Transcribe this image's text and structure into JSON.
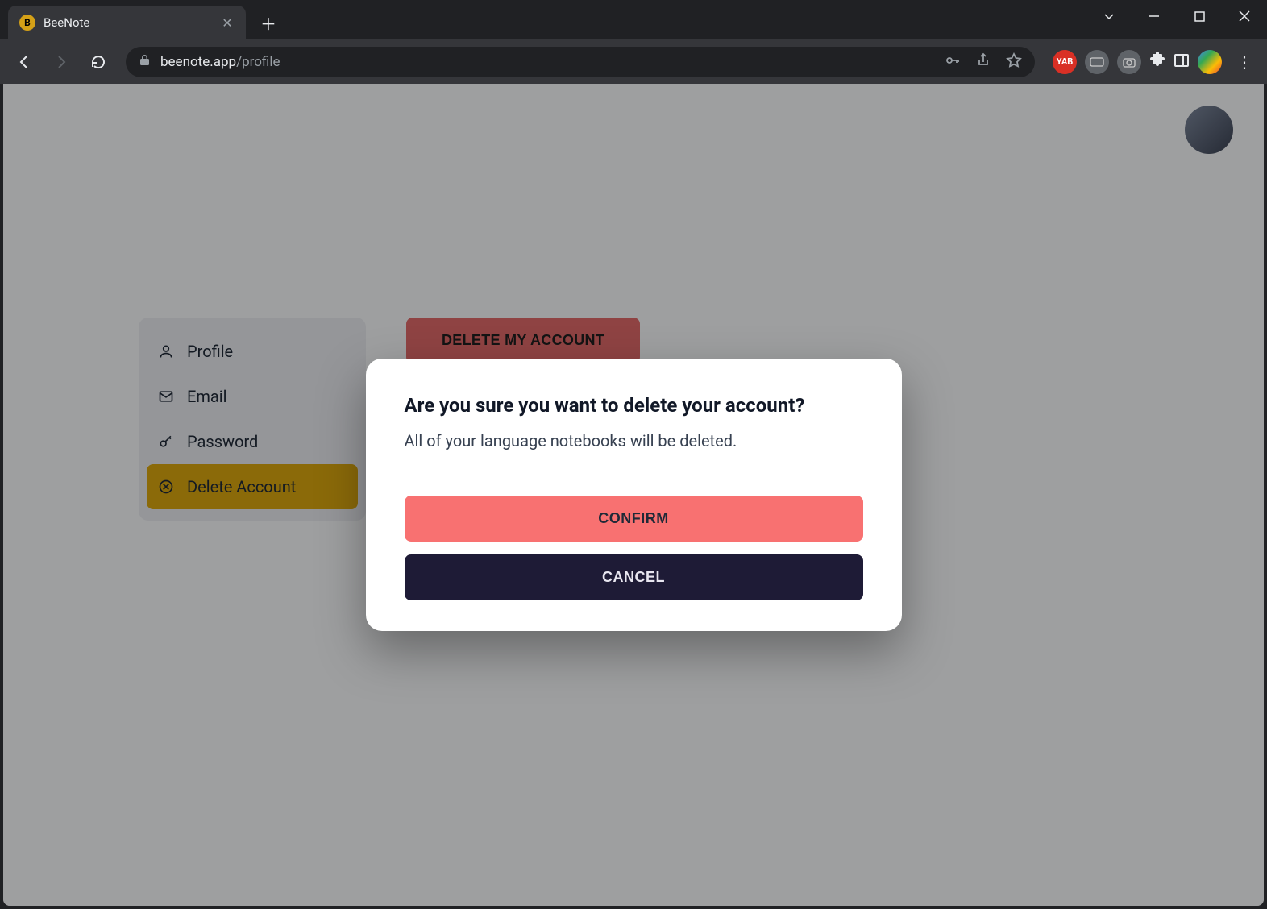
{
  "browser": {
    "tab_title": "BeeNote",
    "url_domain": "beenote.app",
    "url_path": "/profile"
  },
  "header": {
    "avatar_alt": "User avatar"
  },
  "sidebar": {
    "items": [
      {
        "label": "Profile"
      },
      {
        "label": "Email"
      },
      {
        "label": "Password"
      },
      {
        "label": "Delete Account"
      }
    ]
  },
  "main": {
    "delete_button": "DELETE MY ACCOUNT"
  },
  "modal": {
    "title": "Are you sure you want to delete your account?",
    "body": "All of your language notebooks will be deleted.",
    "confirm_label": "CONFIRM",
    "cancel_label": "CANCEL"
  }
}
